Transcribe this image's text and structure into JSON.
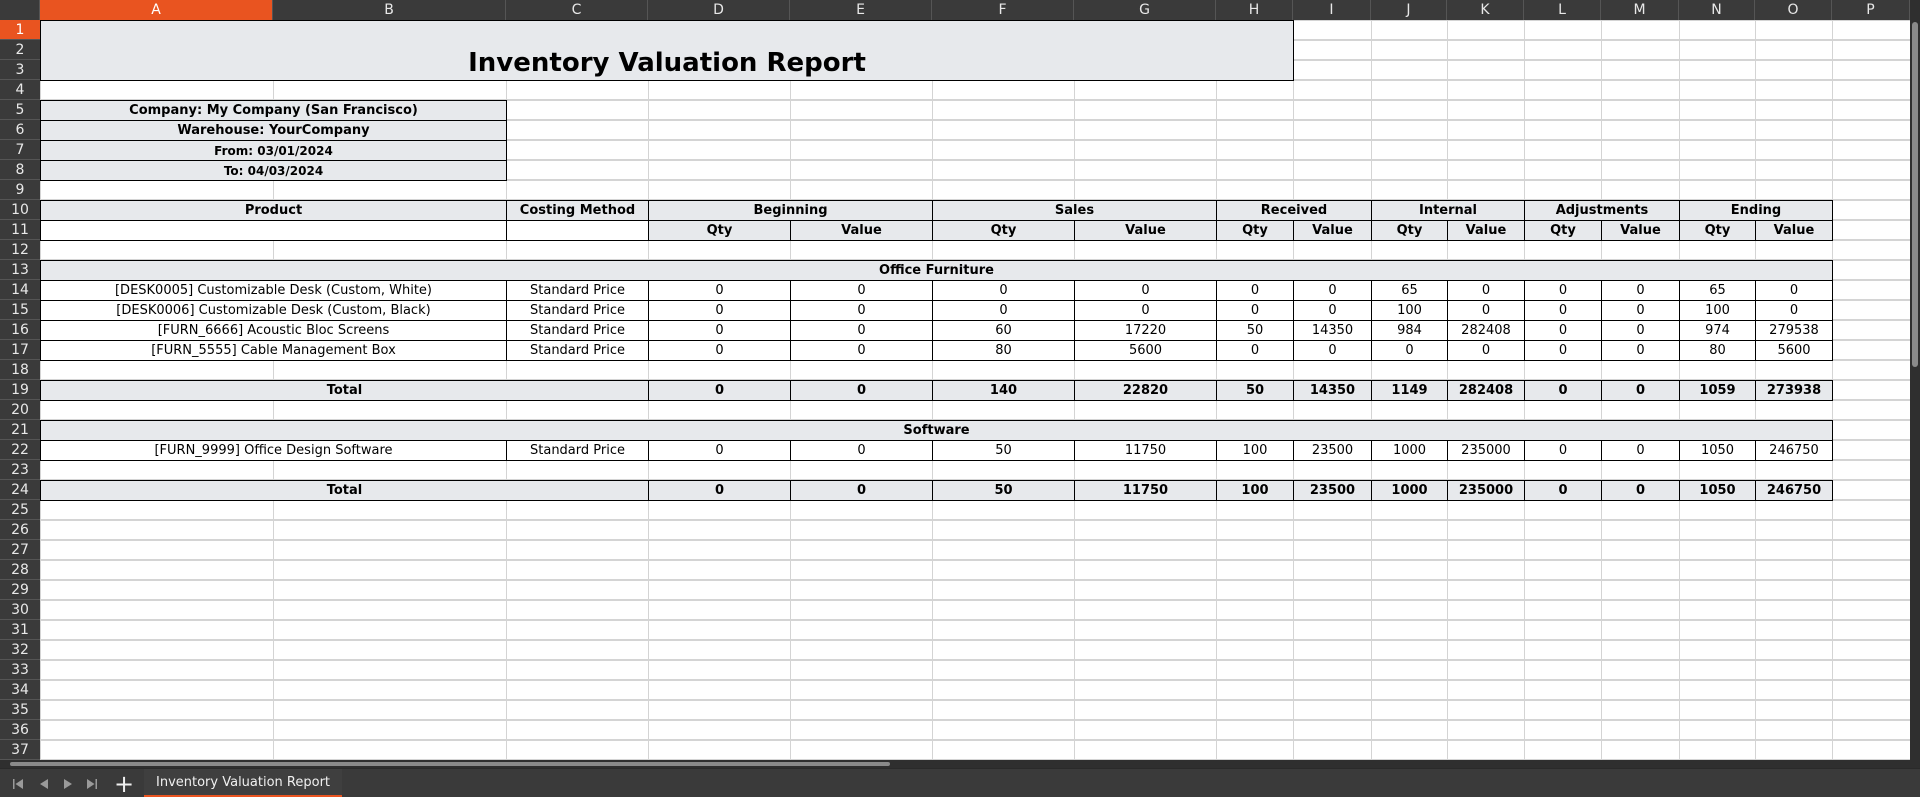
{
  "columns": [
    "A",
    "B",
    "C",
    "D",
    "E",
    "F",
    "G",
    "H",
    "I",
    "J",
    "K",
    "L",
    "M",
    "N",
    "O",
    "P"
  ],
  "rows": [
    "1",
    "2",
    "3",
    "4",
    "5",
    "6",
    "7",
    "8",
    "9",
    "10",
    "11",
    "12",
    "13",
    "14",
    "15",
    "16",
    "17",
    "18",
    "19",
    "20",
    "21",
    "22",
    "23",
    "24",
    "25",
    "26",
    "27",
    "28",
    "29",
    "30",
    "31",
    "32",
    "33",
    "34",
    "35",
    "36",
    "37"
  ],
  "active_column": "A",
  "active_row": "1",
  "report": {
    "title": "Inventory Valuation Report",
    "company": "Company: My Company (San Francisco)",
    "warehouse": "Warehouse: YourCompany",
    "from": "From: 03/01/2024",
    "to": "To: 04/03/2024"
  },
  "headers": {
    "product": "Product",
    "costing_method": "Costing Method",
    "groups": [
      "Beginning",
      "Sales",
      "Received",
      "Internal",
      "Adjustments",
      "Ending"
    ],
    "qty": "Qty",
    "value": "Value"
  },
  "sections": [
    {
      "name": "Office Furniture",
      "rows": [
        {
          "product": "[DESK0005] Customizable Desk (Custom, White)",
          "method": "Standard Price",
          "values": [
            "0",
            "0",
            "0",
            "0",
            "0",
            "0",
            "65",
            "0",
            "0",
            "0",
            "65",
            "0"
          ]
        },
        {
          "product": "[DESK0006] Customizable Desk (Custom, Black)",
          "method": "Standard Price",
          "values": [
            "0",
            "0",
            "0",
            "0",
            "0",
            "0",
            "100",
            "0",
            "0",
            "0",
            "100",
            "0"
          ]
        },
        {
          "product": "[FURN_6666] Acoustic Bloc Screens",
          "method": "Standard Price",
          "values": [
            "0",
            "0",
            "60",
            "17220",
            "50",
            "14350",
            "984",
            "282408",
            "0",
            "0",
            "974",
            "279538"
          ]
        },
        {
          "product": "[FURN_5555] Cable Management Box",
          "method": "Standard Price",
          "values": [
            "0",
            "0",
            "80",
            "5600",
            "0",
            "0",
            "0",
            "0",
            "0",
            "0",
            "80",
            "5600"
          ]
        }
      ],
      "total_label": "Total",
      "totals": [
        "0",
        "0",
        "140",
        "22820",
        "50",
        "14350",
        "1149",
        "282408",
        "0",
        "0",
        "1059",
        "273938"
      ]
    },
    {
      "name": "Software",
      "rows": [
        {
          "product": "[FURN_9999] Office Design Software",
          "method": "Standard Price",
          "values": [
            "0",
            "0",
            "50",
            "11750",
            "100",
            "23500",
            "1000",
            "235000",
            "0",
            "0",
            "1050",
            "246750"
          ]
        }
      ],
      "total_label": "Total",
      "totals": [
        "0",
        "0",
        "50",
        "11750",
        "100",
        "23500",
        "1000",
        "235000",
        "0",
        "0",
        "1050",
        "246750"
      ]
    }
  ],
  "sheet_tab": "Inventory Valuation Report",
  "icons": {
    "first": "first-sheet-icon",
    "prev": "previous-sheet-icon",
    "next": "next-sheet-icon",
    "last": "last-sheet-icon",
    "add": "add-sheet-icon"
  },
  "colors": {
    "accent": "#e95420",
    "header_bg": "#3a3a3a",
    "report_fill": "#e7e9ec"
  }
}
